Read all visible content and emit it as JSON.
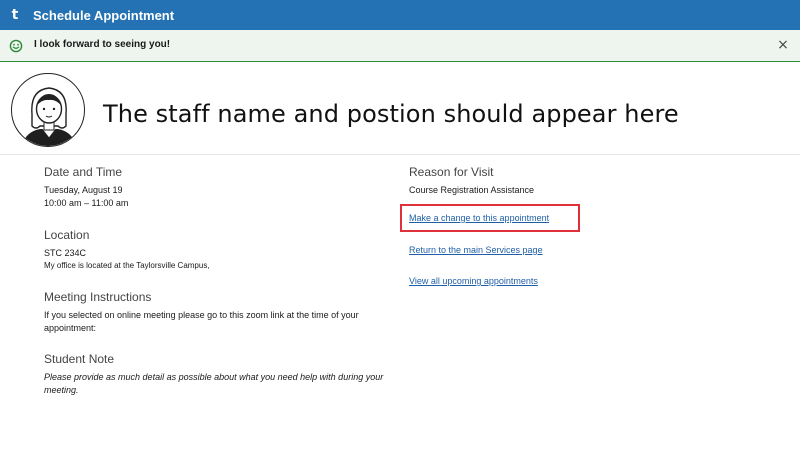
{
  "header": {
    "logo": "t",
    "title": "Schedule Appointment"
  },
  "alert": {
    "message": "I look forward to seeing you!",
    "close": "×"
  },
  "staff": {
    "name_text": "The staff name and postion should appear here"
  },
  "details": {
    "date_time": {
      "title": "Date and Time",
      "date": "Tuesday, August 19",
      "time": "10:00 am – 11:00 am"
    },
    "location": {
      "title": "Location",
      "room": "STC 234C",
      "note": "My office is located at the Taylorsville Campus,"
    },
    "meeting": {
      "title": "Meeting Instructions",
      "line1": "If you selected on online meeting please go to this zoom link at the time of your",
      "line2": "appointment:"
    },
    "student_note": {
      "title": "Student Note",
      "line1": "Please provide as much detail as possible about what you need help with during your",
      "line2": "meeting."
    }
  },
  "reason": {
    "title": "Reason for Visit",
    "value": "Course Registration Assistance"
  },
  "links": {
    "change": "Make a change to this appointment",
    "services": "Return to the main Services page",
    "upcoming": "View all upcoming appointments"
  },
  "colors": {
    "topbar": "#2471b3",
    "alert_bg": "#eef4ee",
    "alert_border": "#2e8b3a",
    "link": "#1f5fa8",
    "highlight": "#e0313a"
  },
  "icons": {
    "smile": "smile-icon",
    "close": "close-icon"
  }
}
